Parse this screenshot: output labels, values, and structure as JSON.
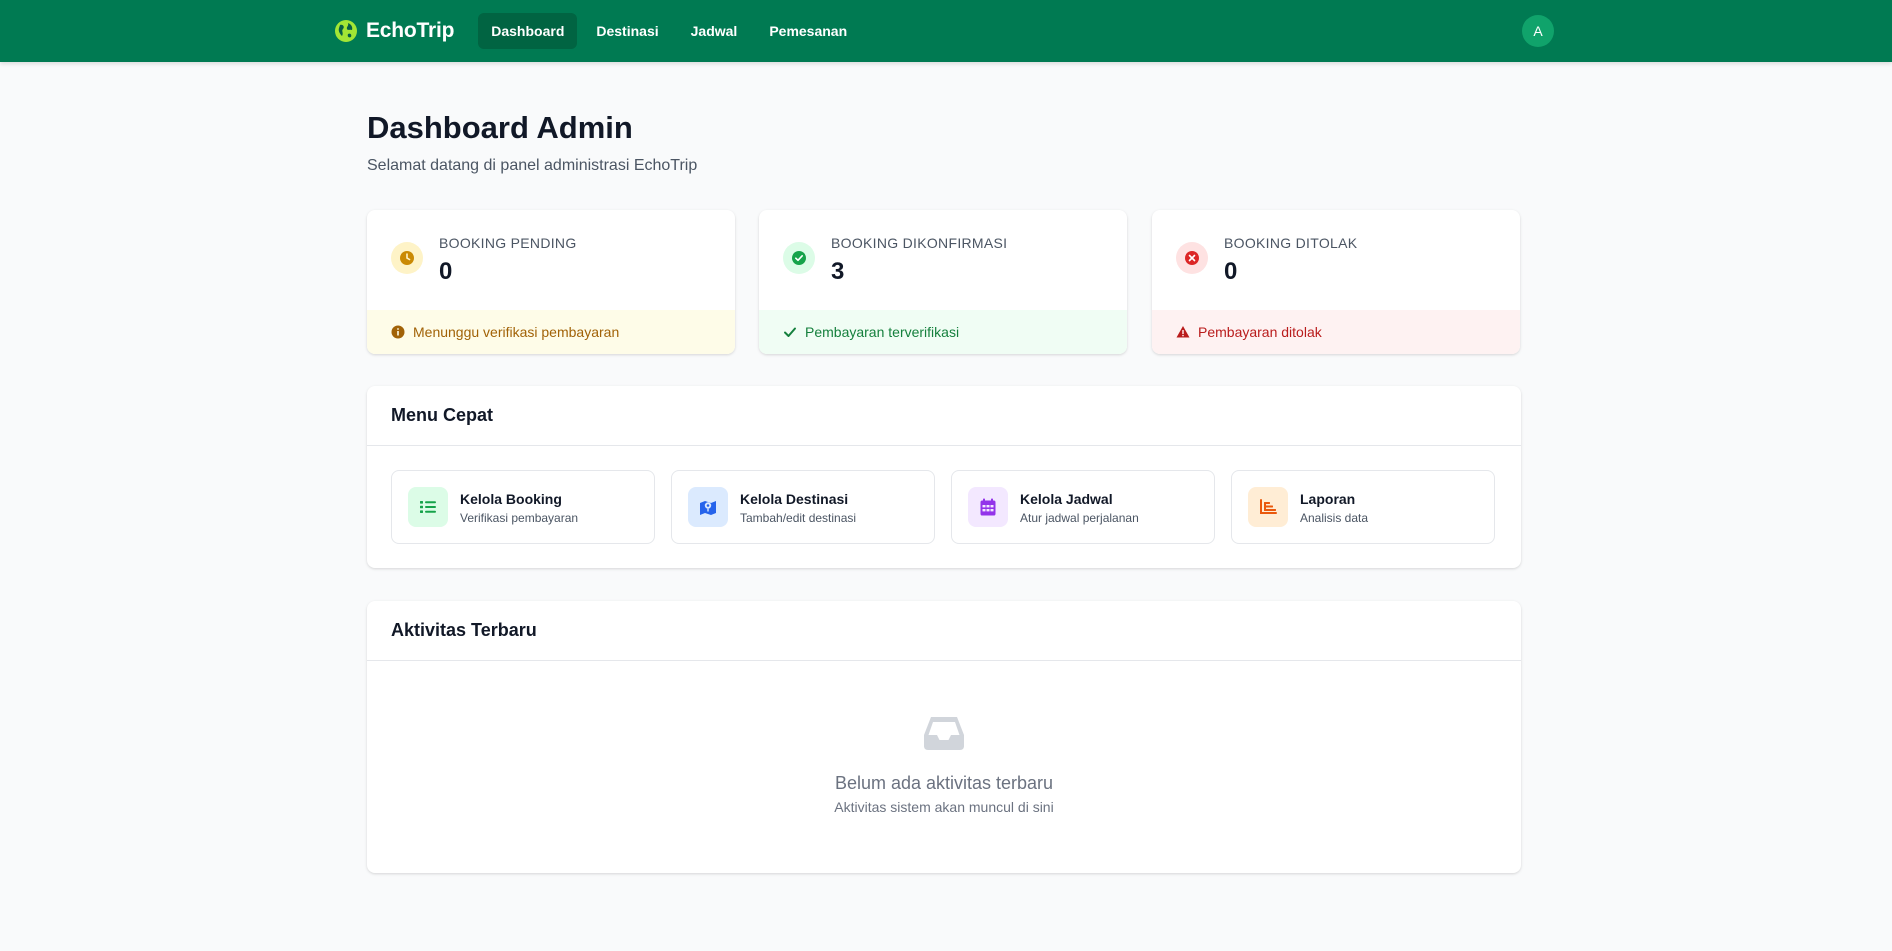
{
  "brand": {
    "name": "EchoTrip"
  },
  "nav": {
    "items": [
      {
        "label": "Dashboard",
        "active": true
      },
      {
        "label": "Destinasi",
        "active": false
      },
      {
        "label": "Jadwal",
        "active": false
      },
      {
        "label": "Pemesanan",
        "active": false
      }
    ],
    "avatar_initial": "A"
  },
  "header": {
    "title": "Dashboard Admin",
    "subtitle": "Selamat datang di panel administrasi EchoTrip"
  },
  "stats": [
    {
      "label": "BOOKING PENDING",
      "value": "0",
      "note": "Menunggu verifikasi pembayaran",
      "icon": "clock-icon",
      "color": "#ca8a04"
    },
    {
      "label": "BOOKING DIKONFIRMASI",
      "value": "3",
      "note": "Pembayaran terverifikasi",
      "icon": "check-circle-icon",
      "color": "#16a34a"
    },
    {
      "label": "BOOKING DITOLAK",
      "value": "0",
      "note": "Pembayaran ditolak",
      "icon": "x-circle-icon",
      "color": "#dc2626"
    }
  ],
  "quick_menu": {
    "title": "Menu Cepat",
    "items": [
      {
        "title": "Kelola Booking",
        "subtitle": "Verifikasi pembayaran",
        "icon": "list-icon",
        "color": "#16a34a"
      },
      {
        "title": "Kelola Destinasi",
        "subtitle": "Tambah/edit destinasi",
        "icon": "map-icon",
        "color": "#2563eb"
      },
      {
        "title": "Kelola Jadwal",
        "subtitle": "Atur jadwal perjalanan",
        "icon": "calendar-icon",
        "color": "#9333ea"
      },
      {
        "title": "Laporan",
        "subtitle": "Analisis data",
        "icon": "chart-icon",
        "color": "#ea580c"
      }
    ]
  },
  "activity": {
    "title": "Aktivitas Terbaru",
    "empty_title": "Belum ada aktivitas terbaru",
    "empty_subtitle": "Aktivitas sistem akan muncul di sini",
    "icon": "inbox-icon"
  }
}
